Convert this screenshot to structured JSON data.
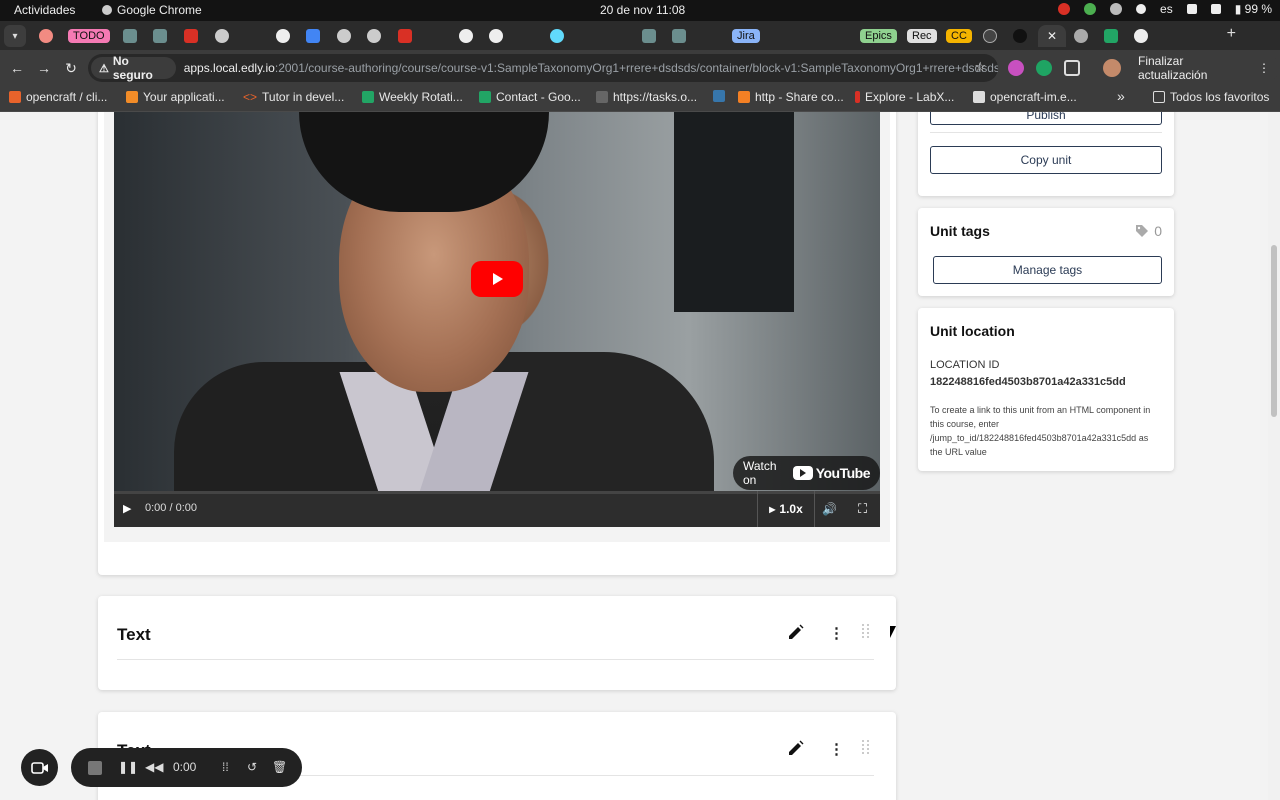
{
  "system_bar": {
    "activities": "Actividades",
    "app_name": "Google Chrome",
    "clock": "20 de nov  11:08",
    "language": "es",
    "battery": "99 %"
  },
  "tabs": [
    {
      "label": "TODO",
      "color": "#f57ab4"
    },
    {
      "label": "Jira",
      "color": "#8ab4f8"
    },
    {
      "label": "Epics",
      "color": "#8fd18f"
    },
    {
      "label": "Rec",
      "color": "#e0e0e0"
    },
    {
      "label": "CC",
      "color": "#f5b400"
    }
  ],
  "toolbar": {
    "security_label": "No seguro",
    "url_host": "apps.local.edly.io",
    "url_path": ":2001/course-authoring/course/course-v1:SampleTaxonomyOrg1+rrere+dsdsds/container/block-v1:SampleTaxonomyOrg1+rrere+dsdsds+type@...",
    "update_label": "Finalizar actualización"
  },
  "bookmarks": [
    {
      "label": "opencraft / cli...",
      "color": "#e8632b"
    },
    {
      "label": "Your applicati...",
      "color": "#f28c28"
    },
    {
      "label": "Tutor in devel...",
      "color": "#bbbbbb"
    },
    {
      "label": "Weekly Rotati...",
      "color": "#22a565"
    },
    {
      "label": "Contact - Goo...",
      "color": "#22a565"
    },
    {
      "label": "https://tasks.o...",
      "color": "#999999"
    },
    {
      "label": "http - Share co...",
      "color": "#f48024"
    },
    {
      "label": "Explore - LabX...",
      "color": "#d93025"
    },
    {
      "label": "opencraft-im.e...",
      "color": "#dddddd"
    }
  ],
  "bookmarks_overflow": "»",
  "bookmarks_all": "Todos los favoritos",
  "video": {
    "watch_on": "Watch on",
    "youtube": "YouTube",
    "time": "0:00 / 0:00",
    "speed": "1.0x"
  },
  "components": [
    {
      "title": "Text"
    },
    {
      "title": "Text"
    }
  ],
  "sidebar": {
    "publish_label": "Publish",
    "copy_unit_label": "Copy unit",
    "tags_title": "Unit tags",
    "tags_count": "0",
    "manage_tags_label": "Manage tags",
    "location_title": "Unit location",
    "location_id_label": "LOCATION ID",
    "location_id": "182248816fed4503b8701a42a331c5dd",
    "location_help": "To create a link to this unit from an HTML component in this course, enter /jump_to_id/182248816fed4503b8701a42a331c5dd as the URL value"
  },
  "recorder": {
    "time": "0:00"
  },
  "colors": {
    "primary_navy": "#2b3b55",
    "youtube_red": "#ff0000"
  }
}
